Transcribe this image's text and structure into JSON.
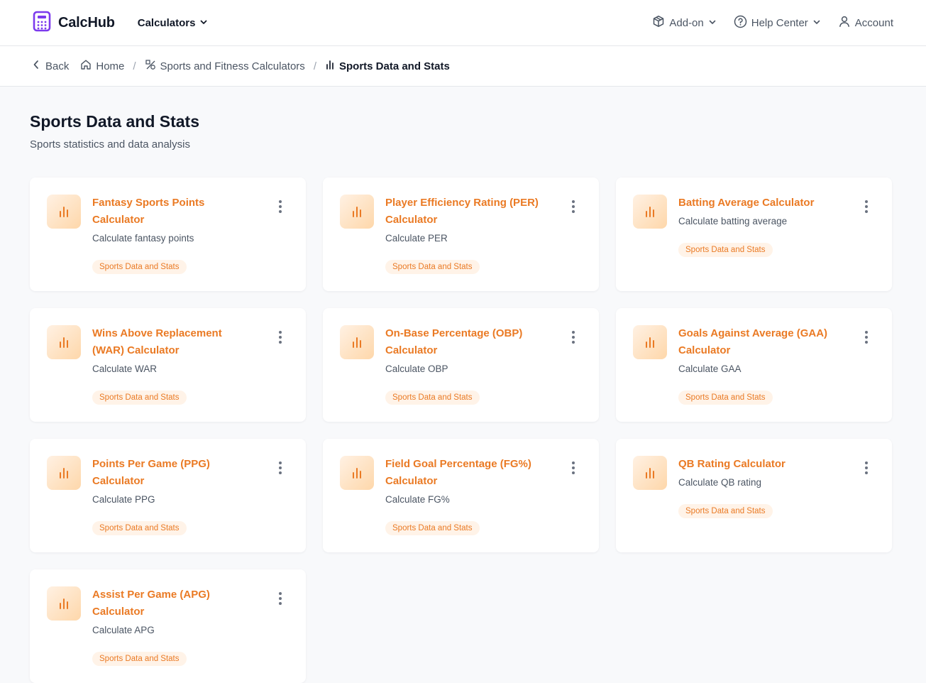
{
  "brand": {
    "name": "CalcHub",
    "accent": "#7c3aed"
  },
  "nav": {
    "calculators_label": "Calculators"
  },
  "topright": {
    "addon_label": "Add-on",
    "help_label": "Help Center",
    "account_label": "Account"
  },
  "breadcrumb": {
    "back_label": "Back",
    "home_label": "Home",
    "category_label": "Sports and Fitness Calculators",
    "current_label": "Sports Data and Stats"
  },
  "page": {
    "title": "Sports Data and Stats",
    "subtitle": "Sports statistics and data analysis"
  },
  "cards": [
    {
      "title": "Fantasy Sports Points Calculator",
      "desc": "Calculate fantasy points",
      "tag": "Sports Data and Stats"
    },
    {
      "title": "Player Efficiency Rating (PER) Calculator",
      "desc": "Calculate PER",
      "tag": "Sports Data and Stats"
    },
    {
      "title": "Batting Average Calculator",
      "desc": "Calculate batting average",
      "tag": "Sports Data and Stats"
    },
    {
      "title": "Wins Above Replacement (WAR) Calculator",
      "desc": "Calculate WAR",
      "tag": "Sports Data and Stats"
    },
    {
      "title": "On-Base Percentage (OBP) Calculator",
      "desc": "Calculate OBP",
      "tag": "Sports Data and Stats"
    },
    {
      "title": "Goals Against Average (GAA) Calculator",
      "desc": "Calculate GAA",
      "tag": "Sports Data and Stats"
    },
    {
      "title": "Points Per Game (PPG) Calculator",
      "desc": "Calculate PPG",
      "tag": "Sports Data and Stats"
    },
    {
      "title": "Field Goal Percentage (FG%) Calculator",
      "desc": "Calculate FG%",
      "tag": "Sports Data and Stats"
    },
    {
      "title": "QB Rating Calculator",
      "desc": "Calculate QB rating",
      "tag": "Sports Data and Stats"
    },
    {
      "title": "Assist Per Game (APG) Calculator",
      "desc": "Calculate APG",
      "tag": "Sports Data and Stats"
    }
  ],
  "colors": {
    "card_title": "#ea7a24",
    "tag_bg": "#fff3e8"
  }
}
